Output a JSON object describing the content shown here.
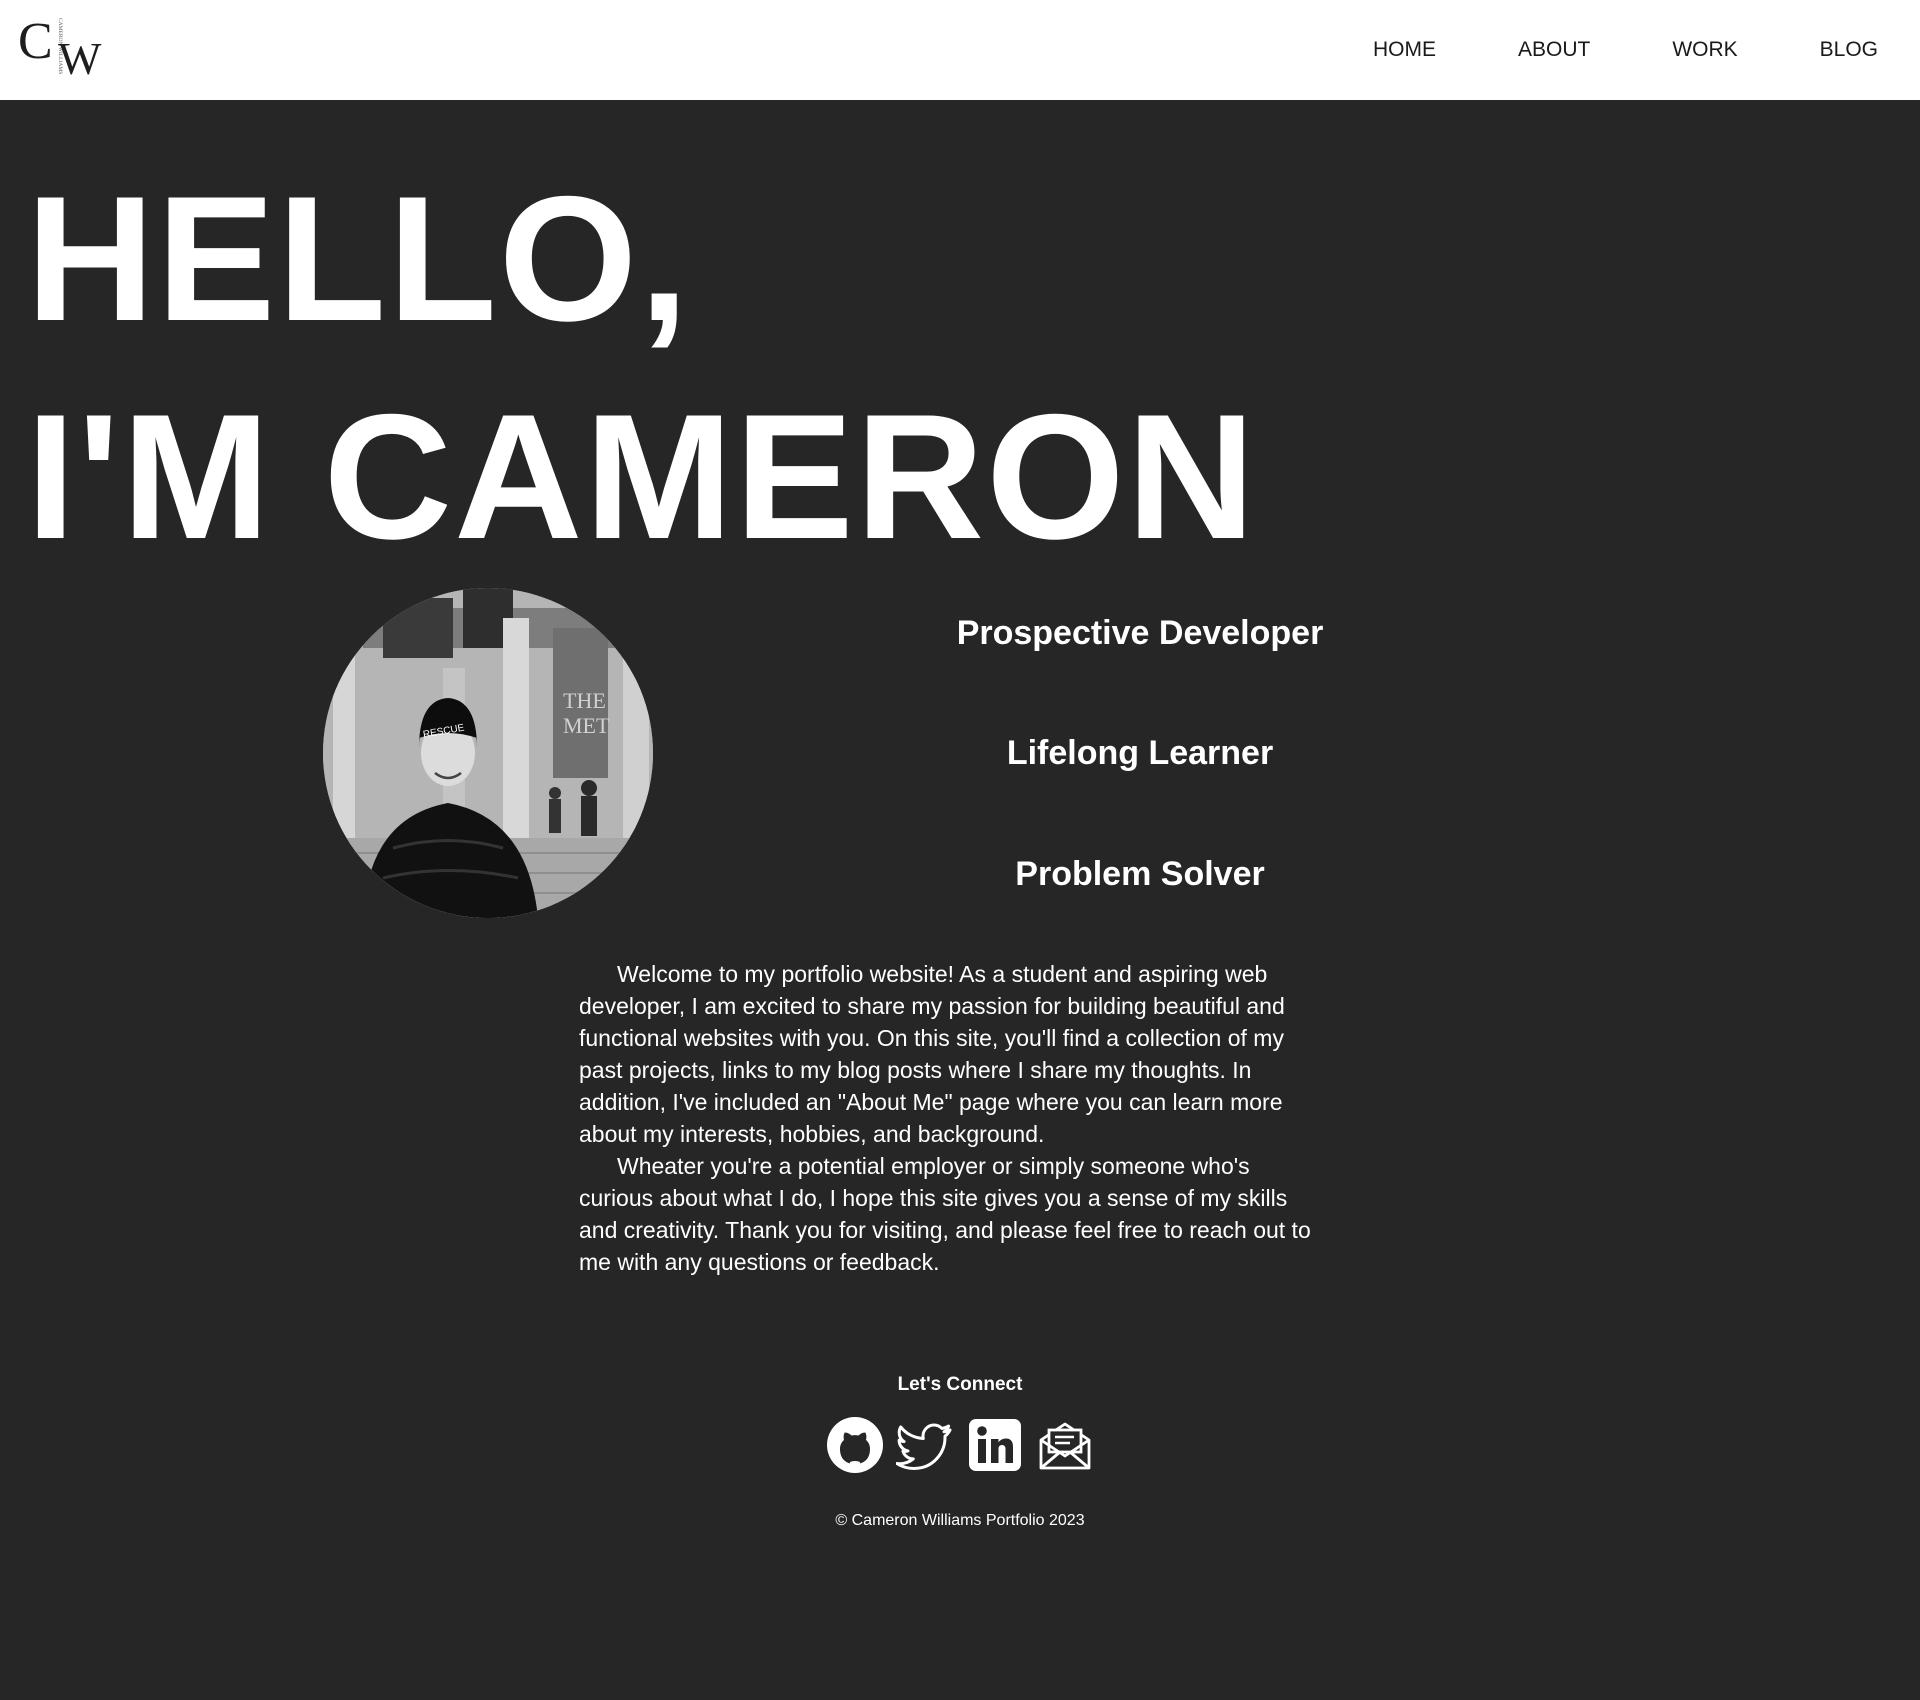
{
  "header": {
    "logo_letters": [
      "C",
      "W"
    ],
    "logo_vertical_text": "CAMERON WILLIAMS",
    "nav": [
      {
        "label": "HOME"
      },
      {
        "label": "ABOUT"
      },
      {
        "label": "WORK"
      },
      {
        "label": "BLOG"
      }
    ]
  },
  "hero": {
    "line1": "HELLO,",
    "line2": "I'M CAMERON"
  },
  "profile": {
    "photo_alt": "Portrait of Cameron"
  },
  "taglines": [
    "Prospective Developer",
    "Lifelong Learner",
    "Problem Solver"
  ],
  "intro": {
    "paragraphs": [
      "Welcome to my portfolio website! As a student and aspiring web developer, I am excited to share my passion for building beautiful and functional websites with you. On this site, you'll find a collection of my past projects, links to my blog posts where I share my thoughts. In addition, I've included an \"About Me\" page where you can learn more about my interests, hobbies, and background.",
      "Wheater you're a potential employer or simply someone who's curious about what I do, I hope this site gives you a sense of my skills and creativity. Thank you for visiting, and please feel free to reach out to me with any questions or feedback."
    ]
  },
  "connect": {
    "title": "Let's Connect",
    "icons": [
      "github-icon",
      "twitter-icon",
      "linkedin-icon",
      "email-icon"
    ]
  },
  "footer": {
    "copyright": "© Cameron Williams Portfolio 2023"
  },
  "colors": {
    "background": "#262626",
    "header_bg": "#ffffff",
    "text": "#ffffff",
    "nav_text": "#1a1a1a"
  }
}
